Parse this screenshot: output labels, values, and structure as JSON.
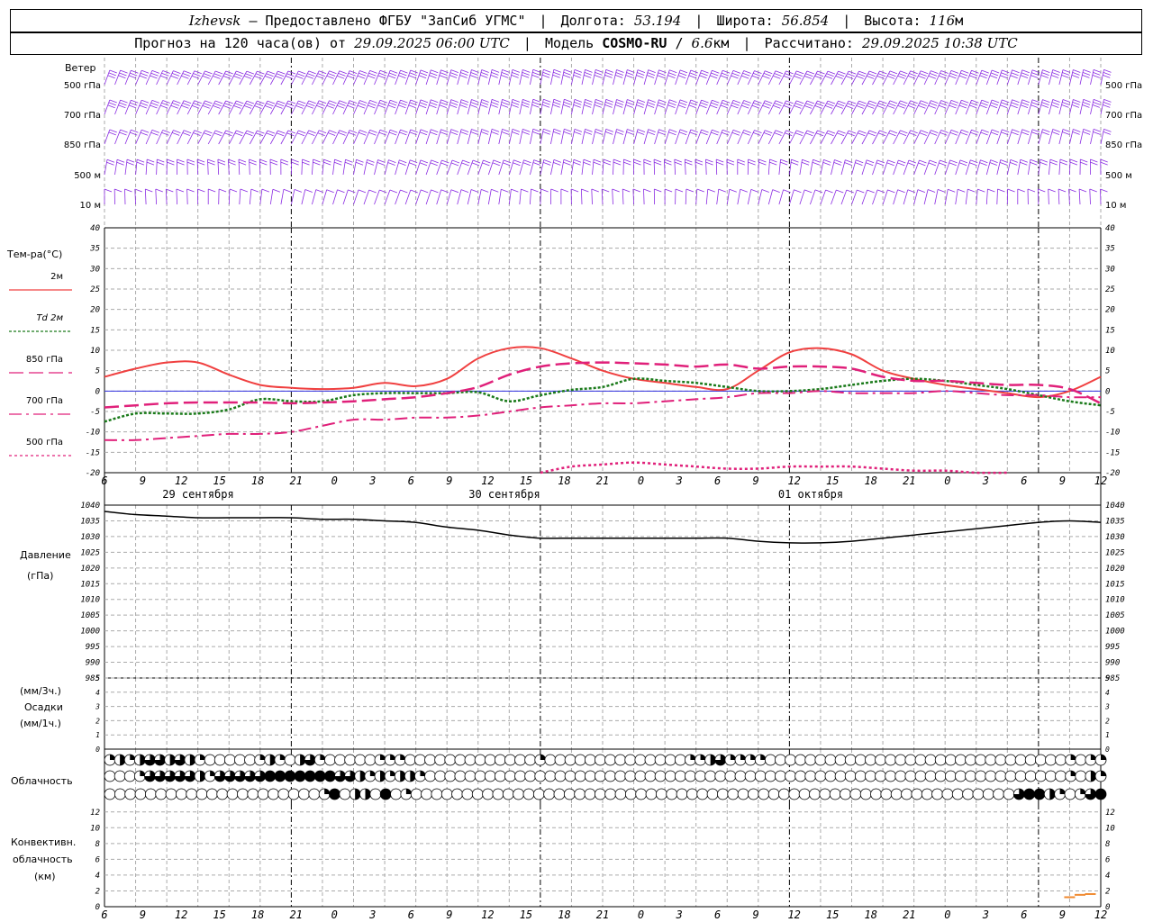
{
  "header": {
    "station": "Izhevsk",
    "dash": "–",
    "provider": "Предоставлено ФГБУ \"ЗапСиб УГМС\"",
    "lon_label": "Долгота:",
    "lon_value": "53.194",
    "lat_label": "Широта:",
    "lat_value": "56.854",
    "alt_label": "Высота:",
    "alt_value": "116",
    "alt_unit": "м",
    "forecast_label": "Прогноз на 120 часа(ов) от",
    "forecast_start": "29.09.2025 06:00 UTC",
    "model_label": "Модель",
    "model_name": "COSMO-RU",
    "model_res": "6.6",
    "model_res_unit": "км",
    "calc_label": "Рассчитано:",
    "calc_time": "29.09.2025 10:38 UTC"
  },
  "wind_panel": {
    "title": "Ветер",
    "levels": [
      "500 гПа",
      "700 гПа",
      "850 гПа",
      "500 м",
      "10 м"
    ]
  },
  "temp_panel": {
    "title": "Тем-ра(°C)",
    "legend": [
      {
        "label": "2м",
        "color": "#f04040",
        "style": "solid"
      },
      {
        "label": "Td 2м",
        "color": "#1a7a1a",
        "style": "dotted"
      },
      {
        "label": "850 гПа",
        "color": "#e0207a",
        "style": "dash"
      },
      {
        "label": "700 гПа",
        "color": "#e0207a",
        "style": "dashdot"
      },
      {
        "label": "500 гПа",
        "color": "#e0207a",
        "style": "dot"
      }
    ]
  },
  "pressure_panel": {
    "title": "Давление",
    "unit": "(гПа)"
  },
  "precip_panel": {
    "unit3": "(мм/3ч.)",
    "title": "Осадки",
    "unit1": "(мм/1ч.)"
  },
  "cloud_panel": {
    "title": "Облачность"
  },
  "conv_panel": {
    "title1": "Конвективн.",
    "title2": "облачность",
    "unit": "(км)"
  },
  "x_axis": {
    "hour_ticks": [
      "6",
      "9",
      "12",
      "15",
      "18",
      "21",
      "0",
      "3",
      "6",
      "9",
      "12",
      "15",
      "18",
      "21",
      "0",
      "3",
      "6",
      "9",
      "12",
      "15",
      "18",
      "21",
      "0",
      "3",
      "6",
      "9",
      "12"
    ],
    "dates": [
      "29 сентября",
      "30 сентября",
      "01 октября"
    ]
  },
  "chart_data": [
    {
      "type": "line",
      "title": "Тем-ра(°C)",
      "x_unit": "hours since 29.09.2025 06:00 UTC",
      "ylim": [
        -20,
        40
      ],
      "yticks": [
        40,
        35,
        30,
        25,
        20,
        15,
        10,
        5,
        0,
        -5,
        -10,
        -15,
        -20
      ],
      "series": [
        {
          "name": "2м",
          "x": [
            0,
            3,
            6,
            9,
            12,
            15,
            18,
            21,
            24,
            27,
            30,
            33,
            36,
            39,
            42,
            45,
            48,
            51,
            54,
            57,
            60,
            63,
            66,
            69,
            72,
            75,
            78,
            81,
            84,
            87,
            90,
            93,
            96
          ],
          "values": [
            3.5,
            5.5,
            7,
            7,
            4,
            1.5,
            0.8,
            0.5,
            0.8,
            2,
            1.2,
            3,
            8,
            10.5,
            10.5,
            8,
            5,
            3,
            2,
            1,
            0.5,
            5,
            9.5,
            10.5,
            9,
            5,
            3,
            1.5,
            0.5,
            -0.5,
            -1.5,
            0,
            3.5
          ]
        },
        {
          "name": "Td 2м",
          "x": [
            0,
            3,
            6,
            9,
            12,
            15,
            18,
            21,
            24,
            27,
            30,
            33,
            36,
            39,
            42,
            45,
            48,
            51,
            54,
            57,
            60,
            63,
            66,
            69,
            72,
            75,
            78,
            81,
            84,
            87,
            90,
            93,
            96
          ],
          "values": [
            -7.5,
            -5.5,
            -5.5,
            -5.5,
            -4.5,
            -2,
            -2.5,
            -2.5,
            -1,
            -0.5,
            -0.5,
            -0.5,
            -0.3,
            -2.5,
            -1,
            0.3,
            1,
            3,
            2.5,
            2,
            1,
            0,
            0,
            0.5,
            1.5,
            2.5,
            3,
            2.5,
            1.5,
            0.5,
            -1,
            -2.5,
            -3.5
          ]
        },
        {
          "name": "850 гПа",
          "x": [
            0,
            3,
            6,
            9,
            12,
            15,
            18,
            21,
            24,
            27,
            30,
            33,
            36,
            39,
            42,
            45,
            48,
            51,
            54,
            57,
            60,
            63,
            66,
            69,
            72,
            75,
            78,
            81,
            84,
            87,
            90,
            93,
            96
          ],
          "values": [
            -4,
            -3.5,
            -3,
            -2.8,
            -2.8,
            -2.8,
            -3,
            -2.8,
            -2.5,
            -2,
            -1.5,
            -0.5,
            1,
            4,
            6,
            6.8,
            7,
            6.8,
            6.5,
            6,
            6.5,
            5.5,
            6,
            6,
            5.5,
            3.5,
            2.5,
            2.5,
            2,
            1.5,
            1.5,
            0.5,
            -3
          ]
        },
        {
          "name": "700 гПа",
          "x": [
            0,
            3,
            6,
            9,
            12,
            15,
            18,
            21,
            24,
            27,
            30,
            33,
            36,
            39,
            42,
            45,
            48,
            51,
            54,
            57,
            60,
            63,
            66,
            69,
            72,
            75,
            78,
            81,
            84,
            87,
            90,
            93,
            96
          ],
          "values": [
            -12,
            -12,
            -11.5,
            -11,
            -10.5,
            -10.5,
            -10,
            -8.5,
            -7,
            -7,
            -6.5,
            -6.5,
            -6,
            -5,
            -4,
            -3.5,
            -3,
            -3,
            -2.5,
            -2,
            -1.5,
            -0.5,
            -0.5,
            0,
            -0.5,
            -0.5,
            -0.5,
            0,
            -0.5,
            -1,
            -1,
            -1.5,
            -1.5
          ]
        },
        {
          "name": "500 гПа",
          "x": [
            42,
            45,
            48,
            51,
            54,
            57,
            60,
            63,
            66,
            69,
            72,
            75,
            78,
            81,
            84,
            87
          ],
          "values": [
            -20,
            -18.5,
            -18,
            -17.5,
            -18,
            -18.5,
            -19,
            -19,
            -18.5,
            -18.5,
            -18.5,
            -19,
            -19.5,
            -19.5,
            -20,
            -20
          ]
        }
      ]
    },
    {
      "type": "line",
      "title": "Давление",
      "ylabel": "(гПа)",
      "x_unit": "hours since 29.09.2025 06:00 UTC",
      "ylim": [
        985,
        1040
      ],
      "yticks": [
        1040,
        1035,
        1030,
        1025,
        1020,
        1015,
        1010,
        1005,
        1000,
        995,
        990,
        985
      ],
      "series": [
        {
          "x": [
            0,
            3,
            6,
            9,
            12,
            15,
            18,
            21,
            24,
            27,
            30,
            33,
            36,
            39,
            42,
            45,
            48,
            51,
            54,
            57,
            60,
            63,
            66,
            69,
            72,
            75,
            78,
            81,
            84,
            87,
            90,
            93,
            96
          ],
          "values": [
            1038,
            1037,
            1036.5,
            1036,
            1036,
            1036,
            1036,
            1035.5,
            1035.5,
            1035,
            1034.5,
            1033,
            1032,
            1030.5,
            1029.5,
            1029.5,
            1029.5,
            1029.5,
            1029.5,
            1029.5,
            1029.5,
            1028.5,
            1028,
            1028,
            1028.5,
            1029.5,
            1030.5,
            1031.5,
            1032.5,
            1033.5,
            1034.5,
            1035,
            1034.5
          ]
        }
      ]
    },
    {
      "type": "line",
      "title": "Осадки",
      "ylabel": "(мм/3ч.)",
      "ylim": [
        0,
        5
      ],
      "yticks": [
        5,
        4,
        3,
        2,
        1,
        0
      ],
      "series": []
    },
    {
      "type": "bar",
      "title": "Конвективн. облачность",
      "ylabel": "(км)",
      "ylim": [
        0,
        13
      ],
      "yticks": [
        12,
        10,
        8,
        6,
        4,
        2,
        0
      ],
      "x_unit": "hours since 29.09.2025 06:00 UTC",
      "series": [
        {
          "color": "#f08a30",
          "x": [
            93,
            94,
            95
          ],
          "values": [
            1.2,
            1.5,
            1.6
          ]
        }
      ]
    }
  ],
  "cloud_rows": {
    "note": "cloud cover per hour, fraction 0..1, rows top to bottom",
    "row1": [
      0.25,
      0.5,
      0.25,
      0.5,
      0.75,
      0.75,
      0.5,
      0.75,
      0.5,
      0.25,
      0,
      0,
      0,
      0,
      0,
      0.25,
      0.5,
      0.25,
      0,
      0.5,
      0.75,
      0.25,
      0,
      0,
      0,
      0,
      0,
      0.25,
      0.25,
      0.25,
      0,
      0,
      0,
      0,
      0,
      0,
      0,
      0,
      0,
      0,
      0,
      0,
      0,
      0.25,
      0,
      0,
      0,
      0,
      0,
      0,
      0,
      0,
      0,
      0,
      0,
      0,
      0,
      0,
      0.25,
      0.25,
      0.5,
      0.75,
      0.25,
      0.25,
      0.25,
      0.25,
      0,
      0,
      0,
      0,
      0,
      0,
      0,
      0,
      0,
      0,
      0,
      0,
      0,
      0,
      0,
      0,
      0,
      0,
      0,
      0,
      0,
      0,
      0,
      0,
      0,
      0,
      0,
      0,
      0,
      0,
      0.25,
      0,
      0.25,
      0.25
    ],
    "row2": [
      0,
      0,
      0,
      0.25,
      0.75,
      0.75,
      0.75,
      0.75,
      0.75,
      0.5,
      0.25,
      0.75,
      0.75,
      0.75,
      0.75,
      0.75,
      1,
      1,
      1,
      1,
      1,
      1,
      1,
      0.75,
      0.75,
      0.5,
      0.25,
      0.5,
      0.25,
      0.5,
      0.5,
      0.25,
      0,
      0,
      0,
      0,
      0,
      0,
      0,
      0,
      0,
      0,
      0,
      0,
      0,
      0,
      0,
      0,
      0,
      0,
      0,
      0,
      0,
      0,
      0,
      0,
      0,
      0,
      0,
      0,
      0,
      0,
      0,
      0,
      0,
      0,
      0,
      0,
      0,
      0,
      0,
      0,
      0,
      0,
      0,
      0,
      0,
      0,
      0,
      0,
      0,
      0,
      0,
      0,
      0,
      0,
      0,
      0,
      0,
      0,
      0,
      0,
      0,
      0,
      0,
      0,
      0.25,
      0,
      0.5,
      0.25
    ],
    "row3": [
      0,
      0,
      0,
      0,
      0,
      0,
      0,
      0,
      0,
      0,
      0,
      0,
      0,
      0,
      0,
      0,
      0,
      0,
      0,
      0,
      0,
      0.25,
      1,
      0,
      0.5,
      0.5,
      0,
      1,
      0,
      0.25,
      0,
      0,
      0,
      0,
      0,
      0,
      0,
      0,
      0,
      0,
      0,
      0,
      0,
      0,
      0,
      0,
      0,
      0,
      0,
      0,
      0,
      0,
      0,
      0,
      0,
      0,
      0,
      0,
      0,
      0,
      0,
      0,
      0,
      0,
      0,
      0,
      0,
      0,
      0,
      0,
      0,
      0,
      0,
      0,
      0,
      0,
      0,
      0,
      0,
      0,
      0,
      0,
      0,
      0,
      0,
      0,
      0,
      0,
      0,
      0.75,
      1,
      1,
      0.5,
      0.25,
      0,
      0.25,
      0.75,
      1
    ]
  },
  "colors": {
    "wind": "#8a2be2",
    "temp2m": "#f04040",
    "td2m": "#1a7a1a",
    "levels": "#e0207a",
    "zero_line": "#3030e0",
    "conv": "#f08a30"
  }
}
